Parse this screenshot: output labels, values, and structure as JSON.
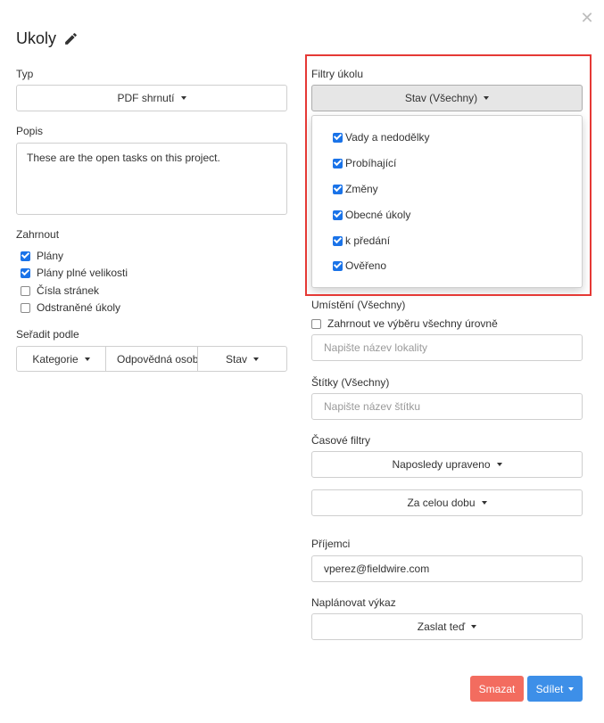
{
  "header": {
    "title": "Ukoly",
    "close_icon": "close-icon",
    "edit_icon": "pencil-icon"
  },
  "left": {
    "type_label": "Typ",
    "type_value": "PDF shrnutí",
    "description_label": "Popis",
    "description_value": "These are the open tasks on this project.",
    "include_label": "Zahrnout",
    "include_options": [
      {
        "label": "Plány",
        "checked": true
      },
      {
        "label": "Plány plné velikosti",
        "checked": true
      },
      {
        "label": "Čísla stránek",
        "checked": false
      },
      {
        "label": "Odstraněné úkoly",
        "checked": false
      }
    ],
    "sort_label": "Seřadit podle",
    "sort_buttons": [
      "Kategorie",
      "Odpovědná osoba",
      "Stav"
    ]
  },
  "right": {
    "filters_label": "Filtry úkolu",
    "status_button": "Stav (Všechny)",
    "status_options": [
      {
        "label": "Vady a nedodělky",
        "checked": true
      },
      {
        "label": "Probíhající",
        "checked": true
      },
      {
        "label": "Změny",
        "checked": true
      },
      {
        "label": "Obecné úkoly",
        "checked": true
      },
      {
        "label": "k předání",
        "checked": true
      },
      {
        "label": "Ověřeno",
        "checked": true
      }
    ],
    "location_label": "Umístění (Všechny)",
    "include_levels_label": "Zahrnout ve výběru všechny úrovně",
    "include_levels_checked": false,
    "location_placeholder": "Napište název lokality",
    "tags_label": "Štítky (Všechny)",
    "tags_placeholder": "Napište název štítku",
    "time_filters_label": "Časové filtry",
    "time_filter_1": "Naposledy upraveno",
    "time_filter_2": "Za celou dobu",
    "recipients_label": "Příjemci",
    "recipients_value": "vperez@fieldwire.com",
    "schedule_label": "Naplánovat výkaz",
    "schedule_value": "Zaslat teď"
  },
  "footer": {
    "delete_label": "Smazat",
    "share_label": "Sdílet"
  },
  "colors": {
    "highlight": "#e53935",
    "checkbox": "#1a73e8",
    "delete": "#f36c5f",
    "share": "#3d8fe8"
  }
}
